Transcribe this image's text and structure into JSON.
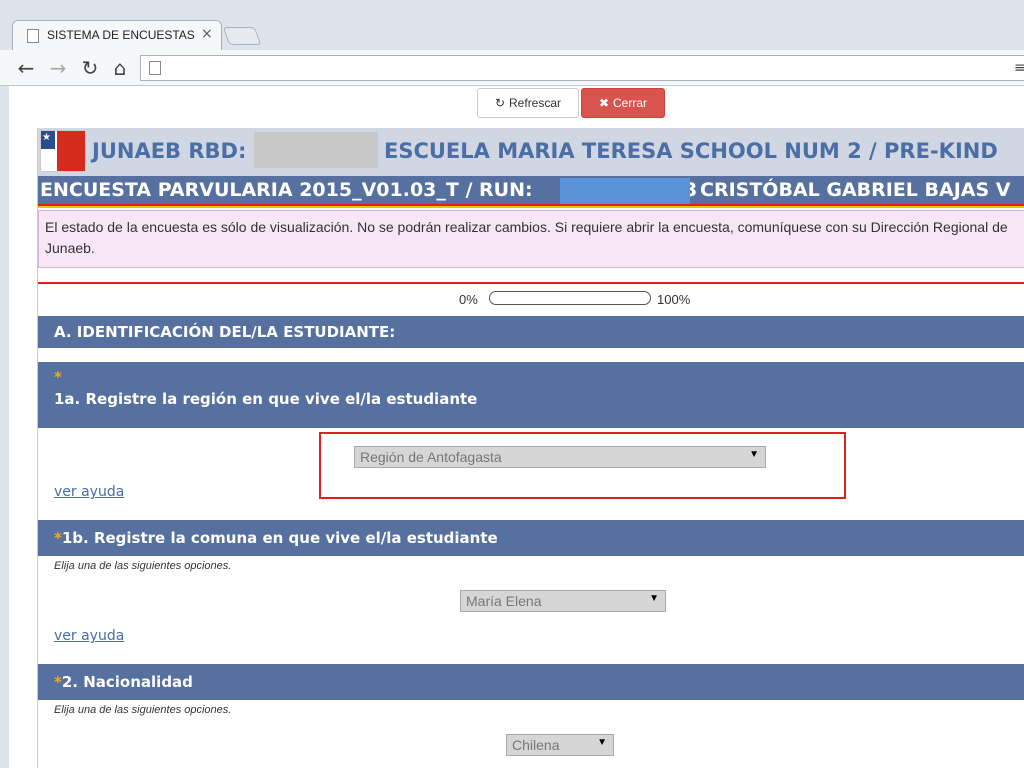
{
  "browser": {
    "tab_title": "SISTEMA DE ENCUESTAS -",
    "tab_close": "×"
  },
  "actions": {
    "refresh_label": "Refrescar",
    "close_label": "Cerrar"
  },
  "header": {
    "rbd_label": "JUNAEB RBD:",
    "school": "ESCUELA MARIA TERESA SCHOOL NUM 2 / PRE-KIND",
    "survey_label": "ENCUESTA PARVULARIA 2015_V01.03_T / RUN:",
    "run_suffix": "3",
    "student_name": "CRISTÓBAL GABRIEL BAJAS V"
  },
  "notice": {
    "text": "El estado de la encuesta es sólo de visualización. No se podrán realizar cambios. Si requiere abrir la encuesta, comuníquese con su Dirección Regional de Junaeb."
  },
  "progress": {
    "start_label": "0%",
    "end_label": "100%",
    "value": 0
  },
  "section": {
    "title": "A. IDENTIFICACIÓN DEL/LA ESTUDIANTE:"
  },
  "questions": [
    {
      "required_mark": "*",
      "label": "1a. Registre la región en que vive el/la estudiante",
      "selected": "Región de Antofagasta",
      "help_link": "ver ayuda"
    },
    {
      "required_mark": "*",
      "label": "1b. Registre la comuna en que vive el/la estudiante",
      "hint": "Elija una de las siguientes opciones.",
      "selected": "María Elena",
      "help_link": "ver ayuda"
    },
    {
      "required_mark": "*",
      "label": "2. Nacionalidad",
      "hint": "Elija una de las siguientes opciones.",
      "selected": "Chilena"
    }
  ],
  "colors": {
    "header_blue": "#5670a0",
    "asterisk": "#f5a623",
    "close_button": "#d9534f",
    "annotation_red": "#e02020"
  }
}
